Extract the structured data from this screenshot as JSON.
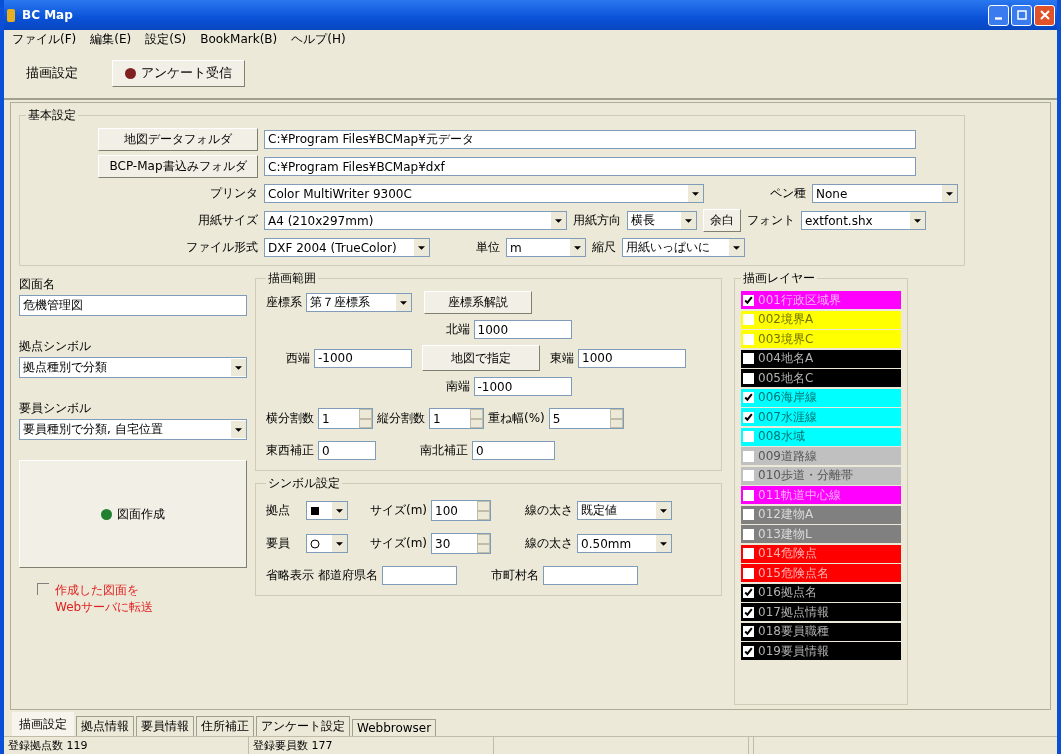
{
  "window": {
    "title": "BC Map"
  },
  "menu": [
    "ファイル(F)",
    "編集(E)",
    "設定(S)",
    "BookMark(B)",
    "ヘルプ(H)"
  ],
  "header": {
    "label": "描画設定",
    "button": "アンケート受信"
  },
  "basic": {
    "title": "基本設定",
    "folders": [
      {
        "button": "地図データフォルダ",
        "value": "C:¥Program Files¥BCMap¥元データ"
      },
      {
        "button": "BCP-Map書込みフォルダ",
        "value": "C:¥Program Files¥BCMap¥dxf"
      }
    ],
    "printer": {
      "label": "プリンタ",
      "value": "Color MultiWriter 9300C"
    },
    "pen": {
      "label": "ペン種",
      "value": "None"
    },
    "paper_size": {
      "label": "用紙サイズ",
      "value": "A4 (210x297mm)"
    },
    "orientation": {
      "label": "用紙方向",
      "value": "横長"
    },
    "margin_button": "余白",
    "font": {
      "label": "フォント",
      "value": "extfont.shx"
    },
    "file_format": {
      "label": "ファイル形式",
      "value": "DXF 2004 (TrueColor)"
    },
    "unit": {
      "label": "単位",
      "value": "m"
    },
    "scale": {
      "label": "縮尺",
      "value": "用紙いっぱいに"
    }
  },
  "left": {
    "drawing_name": {
      "label": "図面名",
      "value": "危機管理図"
    },
    "base_symbol": {
      "label": "拠点シンボル",
      "value": "拠点種別で分類"
    },
    "staff_symbol": {
      "label": "要員シンボル",
      "value": "要員種別で分類, 自宅位置"
    },
    "create_button": "図面作成",
    "upload": {
      "label": "作成した図面をWebサーバに転送",
      "checked": false
    }
  },
  "range": {
    "title": "描画範囲",
    "coord": {
      "label": "座標系",
      "value": "第７座標系"
    },
    "coord_button": "座標系解説",
    "north": {
      "label": "北端",
      "value": "1000"
    },
    "west": {
      "label": "西端",
      "value": "-1000"
    },
    "map_button": "地図で指定",
    "east": {
      "label": "東端",
      "value": "1000"
    },
    "south": {
      "label": "南端",
      "value": "-1000"
    },
    "spinners": [
      {
        "label": "横分割数",
        "value": "1"
      },
      {
        "label": "縦分割数",
        "value": "1"
      },
      {
        "label": "重ね幅(%)",
        "value": "5"
      }
    ],
    "ew": {
      "label": "東西補正",
      "value": "0"
    },
    "ns": {
      "label": "南北補正",
      "value": "0"
    }
  },
  "symbol": {
    "title": "シンボル設定",
    "rows": [
      {
        "label": "拠点",
        "kind": "square",
        "size_label": "サイズ(m)",
        "size": "100",
        "width_label": "線の太さ",
        "width": "既定値"
      },
      {
        "label": "要員",
        "kind": "circle",
        "size_label": "サイズ(m)",
        "size": "30",
        "width_label": "線の太さ",
        "width": "0.50mm"
      }
    ],
    "abbr_label": "省略表示",
    "pref": {
      "label": "都道府県名"
    },
    "city": {
      "label": "市町村名"
    }
  },
  "layers": {
    "title": "描画レイヤー",
    "items": [
      {
        "name": "001行政区域界",
        "checked": true,
        "color": "#ff00ff"
      },
      {
        "name": "002境界A",
        "checked": false,
        "color": "#ffff00"
      },
      {
        "name": "003境界C",
        "checked": false,
        "color": "#ffff00"
      },
      {
        "name": "004地名A",
        "checked": false,
        "color": "#000000"
      },
      {
        "name": "005地名C",
        "checked": false,
        "color": "#000000"
      },
      {
        "name": "006海岸線",
        "checked": true,
        "color": "#00ffff"
      },
      {
        "name": "007水涯線",
        "checked": true,
        "color": "#00ffff"
      },
      {
        "name": "008水域",
        "checked": false,
        "color": "#00ffff"
      },
      {
        "name": "009道路線",
        "checked": false,
        "color": "#c0c0c0"
      },
      {
        "name": "010歩道・分離帯",
        "checked": false,
        "color": "#c0c0c0"
      },
      {
        "name": "011軌道中心線",
        "checked": false,
        "color": "#ff00ff"
      },
      {
        "name": "012建物A",
        "checked": false,
        "color": "#808080"
      },
      {
        "name": "013建物L",
        "checked": false,
        "color": "#808080"
      },
      {
        "name": "014危険点",
        "checked": false,
        "color": "#ff0000"
      },
      {
        "name": "015危険点名",
        "checked": false,
        "color": "#ff0000"
      },
      {
        "name": "016拠点名",
        "checked": true,
        "color": "#000000"
      },
      {
        "name": "017拠点情報",
        "checked": true,
        "color": "#000000"
      },
      {
        "name": "018要員職種",
        "checked": true,
        "color": "#000000"
      },
      {
        "name": "019要員情報",
        "checked": true,
        "color": "#000000"
      }
    ]
  },
  "tabs": [
    {
      "label": "描画設定",
      "selected": true
    },
    {
      "label": "拠点情報",
      "selected": false
    },
    {
      "label": "要員情報",
      "selected": false
    },
    {
      "label": "住所補正",
      "selected": false
    },
    {
      "label": "アンケート設定",
      "selected": false
    },
    {
      "label": "Webbrowser",
      "selected": false
    }
  ],
  "status_bar": [
    "登録拠点数 119",
    "登録要員数 177"
  ]
}
